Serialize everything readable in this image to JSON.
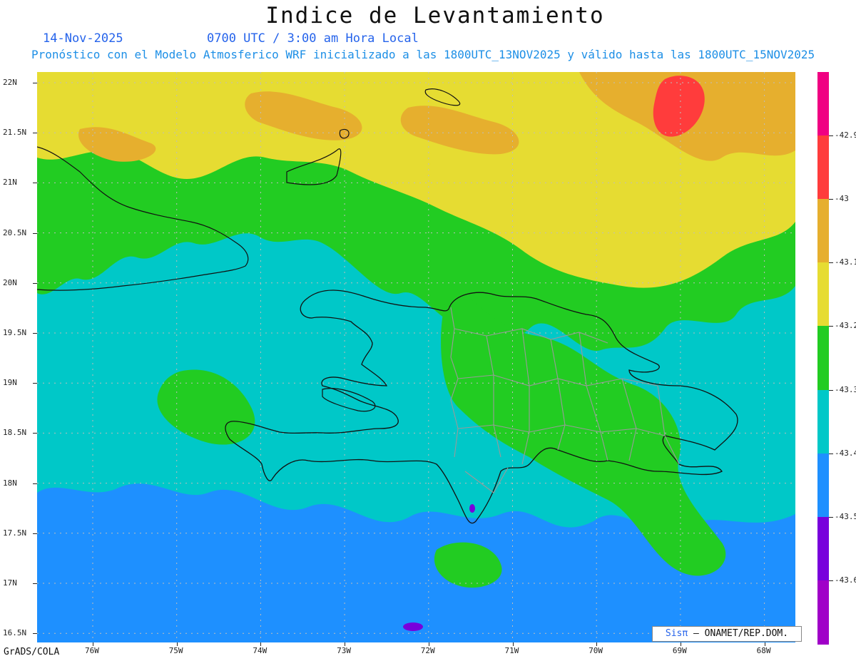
{
  "header": {
    "title": "Indice de Levantamiento",
    "date": "14-Nov-2025",
    "time": "0700 UTC / 3:00 am Hora Local",
    "subtitle": "Pronóstico con el Modelo Atmosferico WRF inicializado a las 1800UTC_13NOV2025 y válido hasta las  1800UTC_15NOV2025"
  },
  "map": {
    "lat_labels": [
      "22N",
      "21.5N",
      "21N",
      "20.5N",
      "20N",
      "19.5N",
      "19N",
      "18.5N",
      "18N",
      "17.5N",
      "17N",
      "16.5N"
    ],
    "lon_labels": [
      "76W",
      "75W",
      "74W",
      "73W",
      "72W",
      "71W",
      "70W",
      "69W",
      "68W"
    ],
    "region": "Hispaniola / Dominican Republic",
    "colors": {
      "ocean_low": "#1e90ff",
      "cyan": "#00c8c8",
      "green": "#22cc22",
      "yellow": "#e6dc32",
      "orange": "#e6af2e",
      "red": "#ff3c3c",
      "coast": "#111111",
      "provinces": "#9a9a9a"
    }
  },
  "legend": {
    "labels": [
      "-42.9",
      "-43",
      "-43.1",
      "-43.2",
      "-43.3",
      "-43.4",
      "-43.5",
      "-43.6"
    ],
    "colors": [
      "#f00082",
      "#ff3c3c",
      "#e6af2e",
      "#e6dc32",
      "#22cc22",
      "#00c8c8",
      "#1e90ff",
      "#7800dc",
      "#a000c8"
    ]
  },
  "footer": {
    "software": "GrADS/COLA",
    "credit_prefix": "Sisπ",
    "credit_suffix": "– ONAMET/REP.DOM."
  }
}
